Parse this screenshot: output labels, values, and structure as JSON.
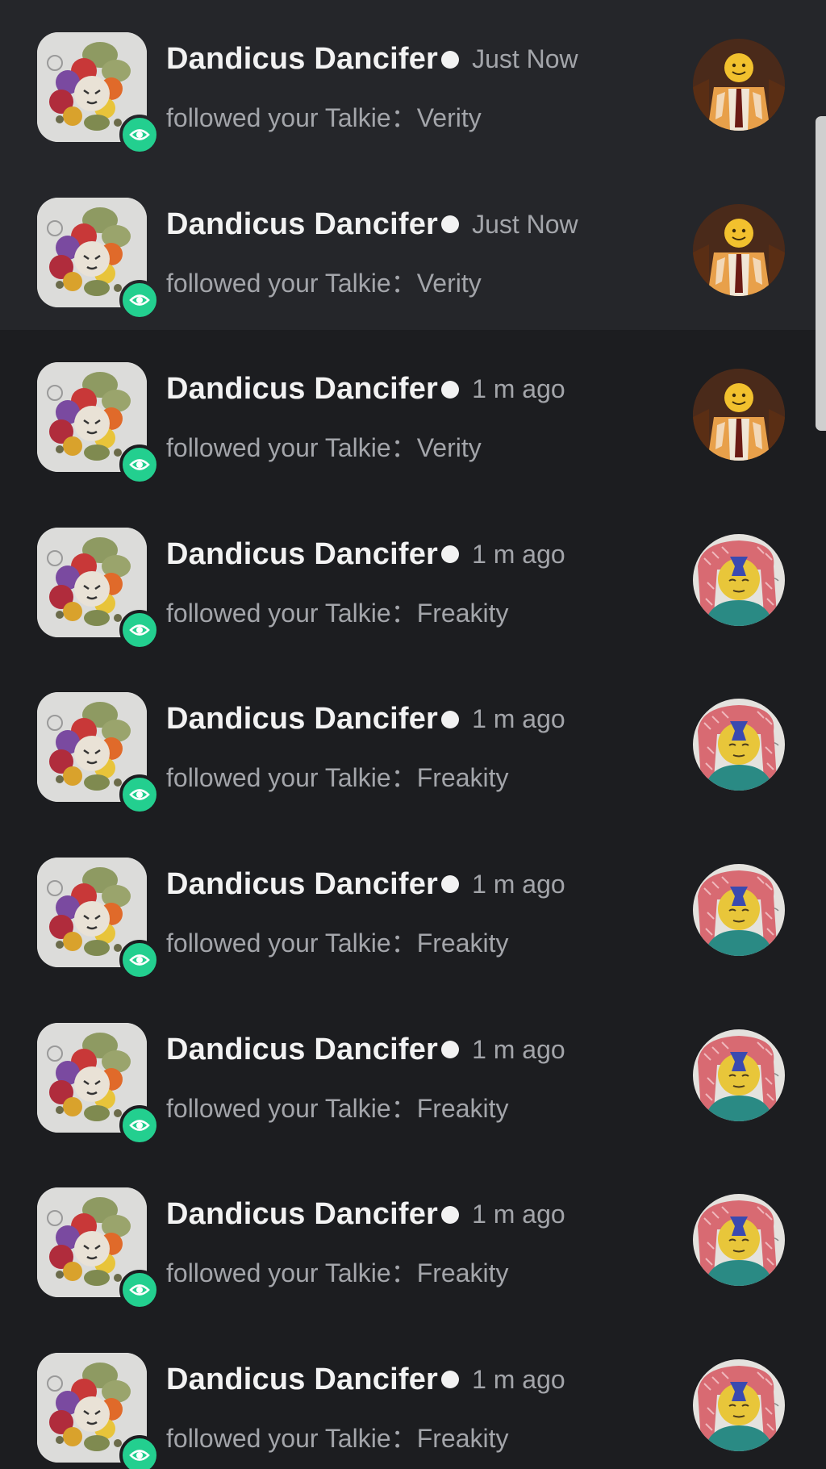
{
  "notifications": [
    {
      "username": "Dandicus Dancifer",
      "time": "Just Now",
      "action": "followed your Talkie",
      "separator": "：",
      "talkie": "Verity",
      "thumb": "verity",
      "unread": true
    },
    {
      "username": "Dandicus Dancifer",
      "time": "Just Now",
      "action": "followed your Talkie",
      "separator": "：",
      "talkie": "Verity",
      "thumb": "verity",
      "unread": true
    },
    {
      "username": "Dandicus Dancifer",
      "time": "1 m ago",
      "action": "followed your Talkie",
      "separator": "：",
      "talkie": "Verity",
      "thumb": "verity",
      "unread": false
    },
    {
      "username": "Dandicus Dancifer",
      "time": "1 m ago",
      "action": "followed your Talkie",
      "separator": "：",
      "talkie": "Freakity",
      "thumb": "freakity",
      "unread": false
    },
    {
      "username": "Dandicus Dancifer",
      "time": "1 m ago",
      "action": "followed your Talkie",
      "separator": "：",
      "talkie": "Freakity",
      "thumb": "freakity",
      "unread": false
    },
    {
      "username": "Dandicus Dancifer",
      "time": "1 m ago",
      "action": "followed your Talkie",
      "separator": "：",
      "talkie": "Freakity",
      "thumb": "freakity",
      "unread": false
    },
    {
      "username": "Dandicus Dancifer",
      "time": "1 m ago",
      "action": "followed your Talkie",
      "separator": "：",
      "talkie": "Freakity",
      "thumb": "freakity",
      "unread": false
    },
    {
      "username": "Dandicus Dancifer",
      "time": "1 m ago",
      "action": "followed your Talkie",
      "separator": "：",
      "talkie": "Freakity",
      "thumb": "freakity",
      "unread": false
    },
    {
      "username": "Dandicus Dancifer",
      "time": "1 m ago",
      "action": "followed your Talkie",
      "separator": "：",
      "talkie": "Freakity",
      "thumb": "freakity",
      "unread": false
    }
  ],
  "icons": {
    "badge": "eye-icon",
    "status_dot": "online-dot"
  },
  "colors": {
    "background": "#1c1d20",
    "unread_background": "#25262a",
    "badge": "#23cf8f",
    "primary_text": "#f2f2f2",
    "secondary_text": "#a3a5aa"
  }
}
